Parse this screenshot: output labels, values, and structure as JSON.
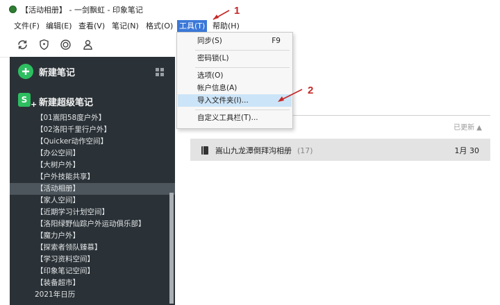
{
  "window": {
    "title": "【活动相册】 - 一剑飘虹 - 印象笔记"
  },
  "menubar": {
    "items": [
      "文件(F)",
      "编辑(E)",
      "查看(V)",
      "笔记(N)",
      "格式(O)",
      "工具(T)",
      "帮助(H)"
    ],
    "active_index": 5
  },
  "toolbar": {
    "icons": [
      "sync-icon",
      "shield-icon",
      "activity-icon",
      "account-icon"
    ]
  },
  "sidebar": {
    "new_note_label": "新建笔记",
    "new_super_note_label": "新建超级笔记",
    "super_icon_letter": "S",
    "super_icon_plus": "+",
    "notebooks": [
      "【01嵩阳58度户外】",
      "【02洛阳千里行户外】",
      "【Quicker动作空间】",
      "【办公空间】",
      "【大树户外】",
      "【户外技能共享】",
      "【活动相册】",
      "【家人空间】",
      "【近期学习计划空间】",
      "【洛阳绿野仙踪户外运动俱乐部】",
      "【魔力户外】",
      "【探索者领队臻慕】",
      "【学习资料空间】",
      "【印象笔记空间】",
      "【装备超市】"
    ],
    "selected_notebook": "【活动相册】",
    "year_item": "2021年日历"
  },
  "tools_menu": {
    "items": [
      {
        "label": "同步(S)",
        "shortcut": "F9"
      },
      {
        "label": "密码锁(L)"
      },
      {
        "label": "选项(O)"
      },
      {
        "label": "帐户信息(A)"
      },
      {
        "label": "导入文件夹(I)...",
        "highlighted": true
      },
      {
        "label": "自定义工具栏(T)..."
      }
    ]
  },
  "main": {
    "sort_label": "已更新 ▲",
    "notebook_row": {
      "name": "嵩山九龙潭倒拜沟相册",
      "count": "(17)",
      "date": "1月 30"
    }
  },
  "annotations": [
    {
      "number": "1"
    },
    {
      "number": "2"
    }
  ],
  "colors": {
    "sidebar_bg": "#2b3237",
    "accent_green": "#2dbe60",
    "menu_active": "#3b78d8",
    "menu_highlight": "#cce4f7",
    "annotation_red": "#c62828"
  }
}
